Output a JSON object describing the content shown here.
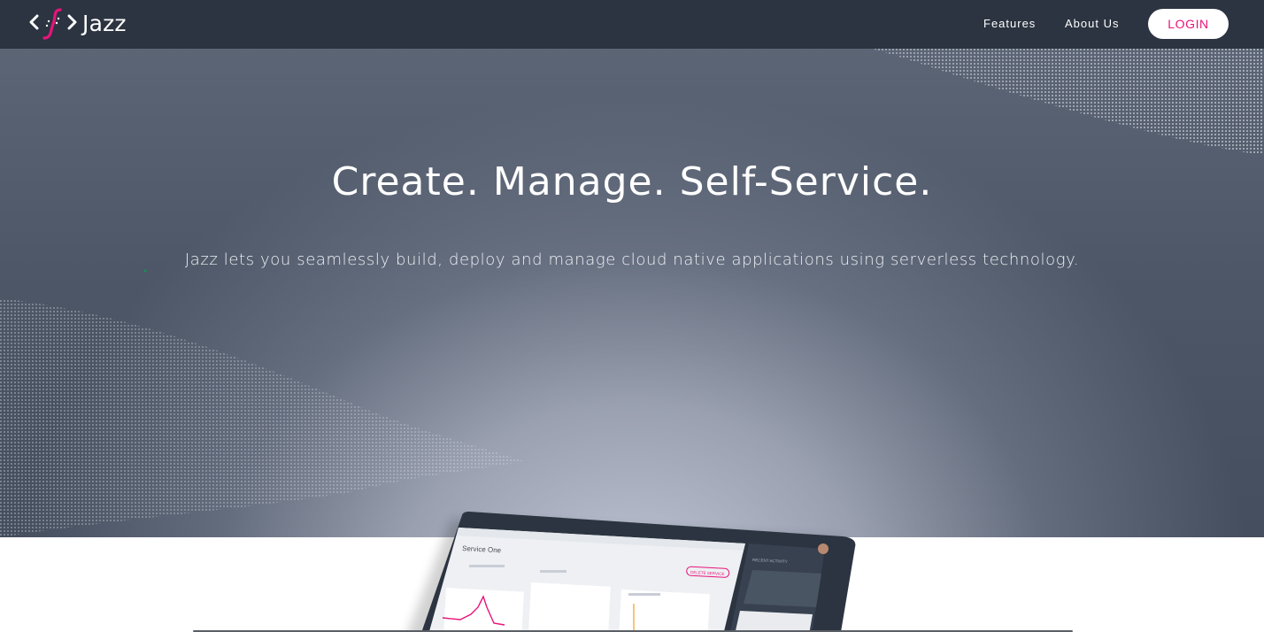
{
  "brand": {
    "name": "Jazz",
    "accent": "#e8147b"
  },
  "nav": {
    "features": "Features",
    "about": "About Us",
    "login": "LOGIN"
  },
  "hero": {
    "title": "Create. Manage. Self-Service.",
    "subtitle": "Jazz lets you seamlessly build, deploy and manage cloud native applications using serverless technology."
  },
  "preview": {
    "service_name": "Service One",
    "button_label": "DELETE SERVICE",
    "panel_title": "RECENT ACTIVITY"
  },
  "colors": {
    "navbar": "#2b3440",
    "hero_dark": "#444e5e",
    "hero_light": "#c8cddc"
  }
}
